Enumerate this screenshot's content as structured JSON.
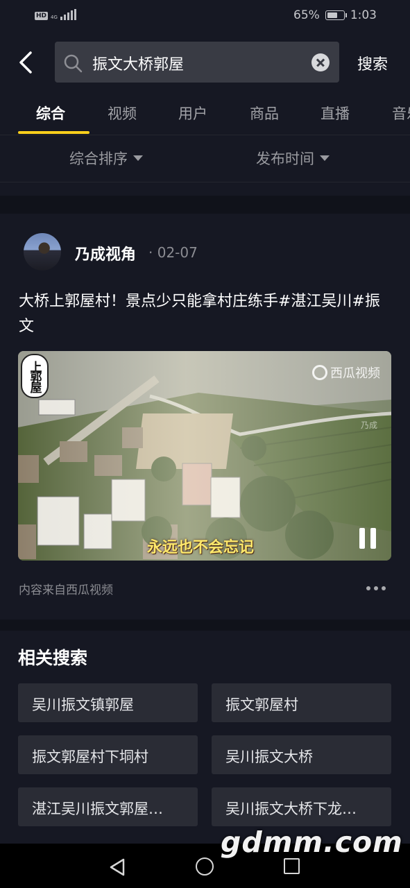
{
  "status_bar": {
    "hd": "HD",
    "network": "4G",
    "battery_text": "65%",
    "battery_level": 0.65,
    "time": "1:03"
  },
  "header": {
    "back_icon": "chevron-left-icon",
    "search_icon": "search-icon",
    "query": "振文大桥郭屋",
    "clear_icon": "clear-icon",
    "search_label": "搜索"
  },
  "tabs": [
    {
      "label": "综合",
      "active": true
    },
    {
      "label": "视频",
      "active": false
    },
    {
      "label": "用户",
      "active": false
    },
    {
      "label": "商品",
      "active": false
    },
    {
      "label": "直播",
      "active": false
    },
    {
      "label": "音乐",
      "active": false
    }
  ],
  "sort": {
    "overall": "综合排序",
    "time": "发布时间"
  },
  "post": {
    "author": "乃成视角",
    "date": "· 02-07",
    "title": "大桥上郭屋村！景点少只能拿村庄练手#湛江吴川#振文",
    "video": {
      "tag": "上郭屋",
      "watermark": "西瓜视频",
      "corner_mark": "乃成",
      "subtitle": "永远也不会忘记",
      "pause_icon": "pause-icon"
    },
    "source": "内容来自西瓜视频",
    "more_icon": "more-icon"
  },
  "related": {
    "title": "相关搜索",
    "items": [
      "吴川振文镇郭屋",
      "振文郭屋村",
      "振文郭屋村下垌村",
      "吴川振文大桥",
      "湛江吴川振文郭屋…",
      "吴川振文大桥下龙…"
    ]
  },
  "nav_bar": {
    "back_icon": "nav-back-icon",
    "home_icon": "nav-home-icon",
    "recent_icon": "nav-recent-icon"
  },
  "watermark": "gdmm.com",
  "colors": {
    "background": "#161823",
    "accent": "#facf1c",
    "chip": "#2a2c35",
    "searchbox": "#393b44"
  }
}
